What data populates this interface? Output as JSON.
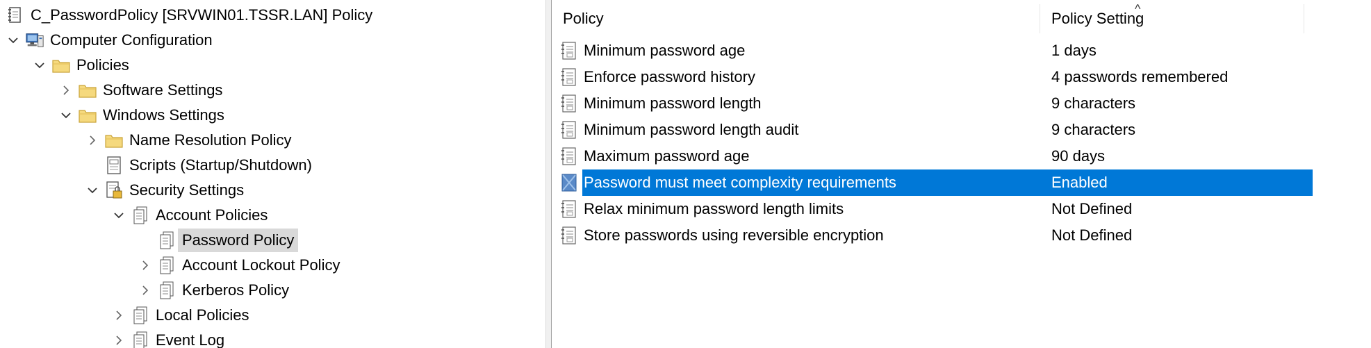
{
  "tree": {
    "root": "C_PasswordPolicy [SRVWIN01.TSSR.LAN] Policy",
    "computer_configuration": "Computer Configuration",
    "policies": "Policies",
    "software_settings": "Software Settings",
    "windows_settings": "Windows Settings",
    "name_resolution_policy": "Name Resolution Policy",
    "scripts": "Scripts (Startup/Shutdown)",
    "security_settings": "Security Settings",
    "account_policies": "Account Policies",
    "password_policy": "Password Policy",
    "account_lockout_policy": "Account Lockout Policy",
    "kerberos_policy": "Kerberos Policy",
    "local_policies": "Local Policies",
    "event_log": "Event Log"
  },
  "list": {
    "col_policy": "Policy",
    "col_setting": "Policy Setting",
    "sort_indicator": "^",
    "rows": [
      {
        "policy": "Minimum password age",
        "setting": "1 days"
      },
      {
        "policy": "Enforce password history",
        "setting": "4 passwords remembered"
      },
      {
        "policy": "Minimum password length",
        "setting": "9 characters"
      },
      {
        "policy": "Minimum password length audit",
        "setting": "9 characters"
      },
      {
        "policy": "Maximum password age",
        "setting": "90 days"
      },
      {
        "policy": "Password must meet complexity requirements",
        "setting": "Enabled"
      },
      {
        "policy": "Relax minimum password length limits",
        "setting": "Not Defined"
      },
      {
        "policy": "Store passwords using reversible encryption",
        "setting": "Not Defined"
      }
    ],
    "selected_index": 5
  },
  "colors": {
    "selection": "#0078d7",
    "tree_selection": "#d9d9d9",
    "folder": "#e8c15a"
  }
}
